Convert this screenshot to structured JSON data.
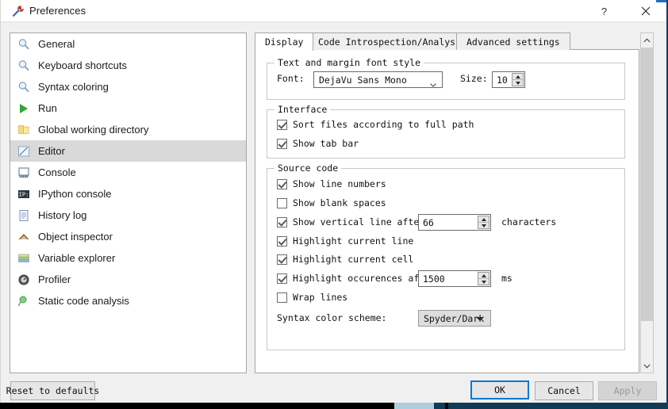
{
  "window": {
    "title": "Preferences",
    "icon": "wrench-screwdriver-icon",
    "help_label": "?",
    "close_label": "×"
  },
  "sidebar": {
    "selected_index": 5,
    "items": [
      {
        "label": "General",
        "icon": "magnifier-icon"
      },
      {
        "label": "Keyboard shortcuts",
        "icon": "magnifier-icon"
      },
      {
        "label": "Syntax coloring",
        "icon": "magnifier-icon"
      },
      {
        "label": "Run",
        "icon": "play-triangle-icon"
      },
      {
        "label": "Global working directory",
        "icon": "folder-icon"
      },
      {
        "label": "Editor",
        "icon": "editor-pencil-icon"
      },
      {
        "label": "Console",
        "icon": "console-icon"
      },
      {
        "label": "IPython console",
        "icon": "ipython-icon"
      },
      {
        "label": "History log",
        "icon": "notebook-icon"
      },
      {
        "label": "Object inspector",
        "icon": "book-icon"
      },
      {
        "label": "Variable explorer",
        "icon": "table-icon"
      },
      {
        "label": "Profiler",
        "icon": "gauge-icon"
      },
      {
        "label": "Static code analysis",
        "icon": "pin-icon"
      }
    ]
  },
  "tabs": {
    "active_index": 0,
    "items": [
      {
        "label": "Display"
      },
      {
        "label": "Code Introspection/Analysis"
      },
      {
        "label": "Advanced settings"
      }
    ]
  },
  "display_tab": {
    "font_group": {
      "legend": "Text and margin font style",
      "font_label": "Font:",
      "font_value": "DejaVu Sans Mono",
      "size_label": "Size:",
      "size_value": "10"
    },
    "interface_group": {
      "legend": "Interface",
      "options": [
        {
          "label": "Sort files according to full path",
          "checked": true
        },
        {
          "label": "Show tab bar",
          "checked": true
        }
      ]
    },
    "source_group": {
      "legend": "Source code",
      "show_line_numbers": {
        "label": "Show line numbers",
        "checked": true
      },
      "show_blank_spaces": {
        "label": "Show blank spaces",
        "checked": false
      },
      "vertical_line": {
        "label": "Show vertical line after",
        "checked": true,
        "value": "66",
        "suffix": "characters"
      },
      "highlight_current_line": {
        "label": "Highlight current line",
        "checked": true
      },
      "highlight_current_cell": {
        "label": "Highlight current cell",
        "checked": true
      },
      "highlight_occurrences": {
        "label": "Highlight occurences after",
        "checked": true,
        "value": "1500",
        "suffix": "ms"
      },
      "wrap_lines": {
        "label": "Wrap lines",
        "checked": false
      },
      "color_scheme": {
        "label": "Syntax color scheme:",
        "value": "Spyder/Dark"
      }
    }
  },
  "footer": {
    "reset_label": "Reset to defaults",
    "ok_label": "OK",
    "cancel_label": "Cancel",
    "apply_label": "Apply",
    "apply_disabled": true
  },
  "colors": {
    "accent": "#0078d7",
    "selection": "#d9d9d9",
    "window_bg": "#f0f0f0",
    "panel_bg": "#ffffff",
    "border": "#a6a6a6"
  }
}
